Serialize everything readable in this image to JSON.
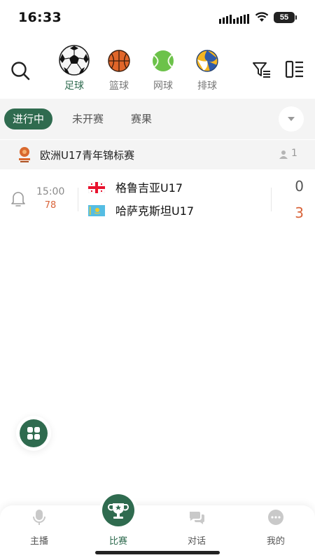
{
  "status_bar": {
    "time": "16:33",
    "battery": "55"
  },
  "sports": [
    {
      "label": "足球",
      "icon": "soccer-ball-icon",
      "active": true
    },
    {
      "label": "篮球",
      "icon": "basketball-icon",
      "active": false
    },
    {
      "label": "网球",
      "icon": "tennis-ball-icon",
      "active": false
    },
    {
      "label": "排球",
      "icon": "volleyball-icon",
      "active": false
    }
  ],
  "status_tabs": [
    {
      "label": "进行中",
      "active": true
    },
    {
      "label": "未开赛",
      "active": false
    },
    {
      "label": "赛果",
      "active": false
    }
  ],
  "league": {
    "name": "欧洲U17青年锦标赛",
    "followers": "1"
  },
  "match": {
    "time": "15:00",
    "minute": "78",
    "home": {
      "name": "格鲁吉亚U17",
      "score": "0"
    },
    "away": {
      "name": "哈萨克斯坦U17",
      "score": "3"
    }
  },
  "bottom_nav": [
    {
      "label": "主播",
      "icon": "microphone-icon",
      "active": false
    },
    {
      "label": "比赛",
      "icon": "trophy-icon",
      "active": true
    },
    {
      "label": "对话",
      "icon": "chat-bubbles-icon",
      "active": false
    },
    {
      "label": "我的",
      "icon": "profile-dots-icon",
      "active": false
    }
  ],
  "colors": {
    "accent": "#2f6b4f",
    "live_minute": "#d9643a",
    "away_score": "#d9643a"
  }
}
